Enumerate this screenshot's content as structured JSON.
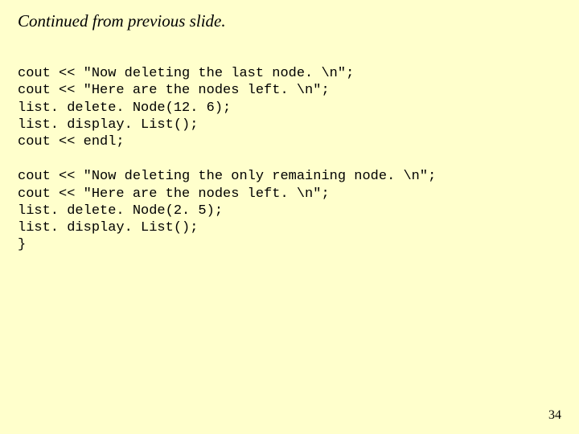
{
  "header": {
    "note": "Continued from previous slide."
  },
  "code": {
    "block1": "cout << \"Now deleting the last node. \\n\";\ncout << \"Here are the nodes left. \\n\";\nlist. delete. Node(12. 6);\nlist. display. List();\ncout << endl;",
    "block2": "cout << \"Now deleting the only remaining node. \\n\";\ncout << \"Here are the nodes left. \\n\";\nlist. delete. Node(2. 5);\nlist. display. List();\n}"
  },
  "footer": {
    "page_number": "34"
  }
}
